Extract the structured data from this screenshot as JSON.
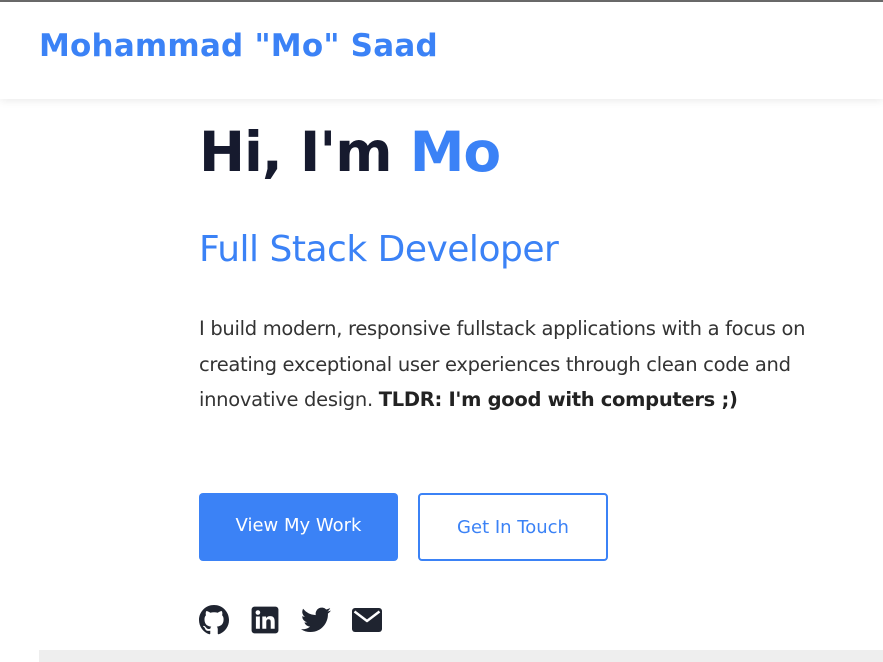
{
  "header": {
    "brand": "Mohammad \"Mo\" Saad"
  },
  "hero": {
    "greeting_prefix": "Hi, I'm ",
    "greeting_name": "Mo",
    "role": "Full Stack Developer",
    "bio_text": "I build modern, responsive fullstack applications with a focus on creating exceptional user experiences through clean code and innovative design. ",
    "bio_bold": "TLDR: I'm good with computers ;)"
  },
  "actions": {
    "primary_label": "View My Work",
    "secondary_label": "Get In Touch"
  },
  "socials": [
    {
      "icon": "github-icon"
    },
    {
      "icon": "linkedin-icon"
    },
    {
      "icon": "twitter-icon"
    },
    {
      "icon": "mail-icon"
    }
  ],
  "colors": {
    "accent": "#3b82f6",
    "heading": "#161a2e",
    "body_text": "#333333",
    "icon": "#1f2430"
  }
}
